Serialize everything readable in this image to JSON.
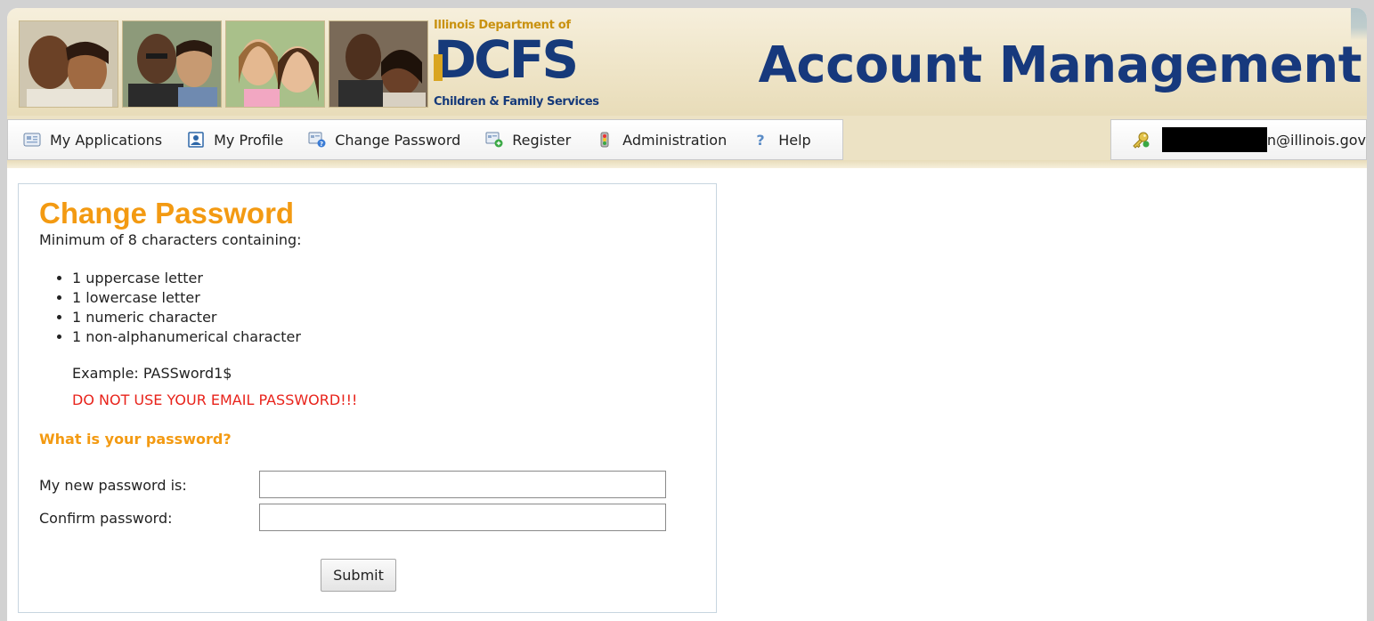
{
  "header": {
    "agency_top": "Illinois Department of",
    "agency_mark": "DCFS",
    "agency_bottom": "Children & Family Services",
    "title": "Account Management"
  },
  "nav": {
    "items": [
      {
        "label": "My Applications",
        "icon": "applications-icon"
      },
      {
        "label": "My Profile",
        "icon": "profile-icon"
      },
      {
        "label": "Change Password",
        "icon": "change-password-icon"
      },
      {
        "label": "Register",
        "icon": "register-icon"
      },
      {
        "label": "Administration",
        "icon": "administration-icon"
      },
      {
        "label": "Help",
        "icon": "help-icon"
      }
    ]
  },
  "user": {
    "email_suffix": "n@illinois.gov",
    "icon": "key-user-icon"
  },
  "form": {
    "title": "Change Password",
    "intro": "Minimum of 8 characters containing:",
    "rules": [
      "1 uppercase letter",
      "1 lowercase letter",
      "1 numeric character",
      "1 non-alphanumerical character"
    ],
    "example": "Example: PASSword1$",
    "warning": "DO NOT USE YOUR EMAIL PASSWORD!!!",
    "section_heading": "What is your password?",
    "new_password_label": "My new password is:",
    "new_password_value": "",
    "confirm_password_label": "Confirm password:",
    "confirm_password_value": "",
    "submit_label": "Submit"
  },
  "colors": {
    "title_navy": "#17397d",
    "accent_orange": "#f39a12",
    "warning_red": "#e8231b",
    "header_tan": "#efe5c8"
  }
}
